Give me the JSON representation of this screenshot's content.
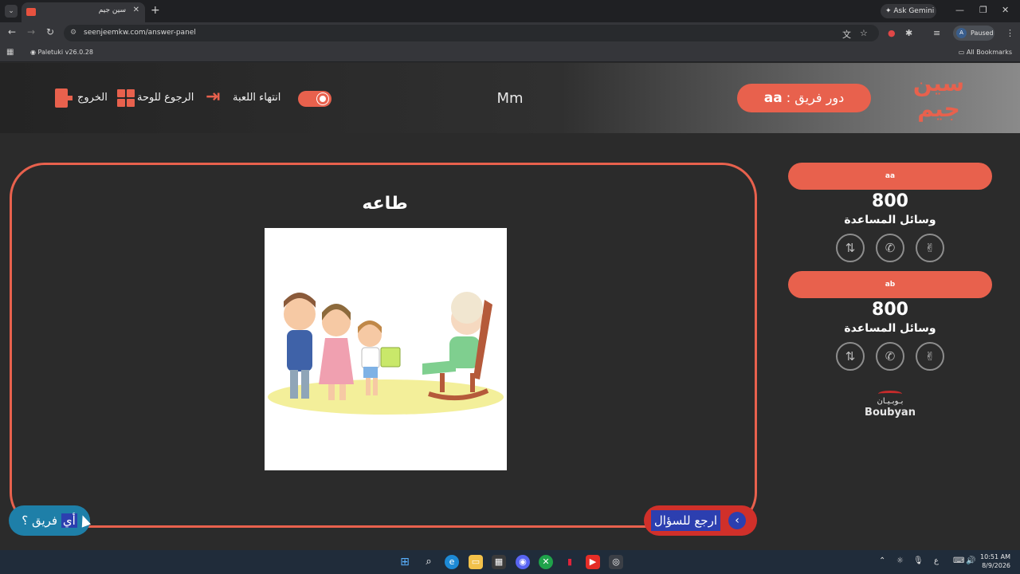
{
  "browser": {
    "tab_title": "سين جيم",
    "tab_close": "✕",
    "new_tab": "+",
    "ask_gemini": "✦ Ask Gemini",
    "url": "seenjeemkw.com/answer-panel",
    "profile_initial": "A",
    "profile_status": "Paused",
    "bookmark_item": "Paletuki v26.0.28",
    "all_bookmarks": "All Bookmarks"
  },
  "header": {
    "logo_line1": "سين",
    "logo_line2": "جيم",
    "turn_label": "دور فريق : ",
    "turn_team": "aa",
    "game_name": "Mm",
    "end_game_label": "انتهاء اللعبة",
    "back_to_board_label": "الرجوع للوحة",
    "exit_label": "الخروج"
  },
  "question": {
    "title": "طاعه",
    "back_to_question_label": "ارجع للسؤال",
    "which_team_label_highlight": "أي",
    "which_team_label_rest": " فريق ؟"
  },
  "teams": [
    {
      "name": "aa",
      "score": "800",
      "help_label": "وسائل المساعدة"
    },
    {
      "name": "ab",
      "score": "800",
      "help_label": "وسائل المساعدة"
    }
  ],
  "sponsor": {
    "arabic": "بـوبـيـان",
    "english": "Boubyan"
  },
  "taskbar": {
    "time": "10:51 AM",
    "date": "8/9/2026",
    "lang": "ع"
  },
  "colors": {
    "accent": "#e8614d",
    "back_pill": "#d0302a",
    "team_pill": "#1e7fa8",
    "selection": "#2c3fb0"
  }
}
